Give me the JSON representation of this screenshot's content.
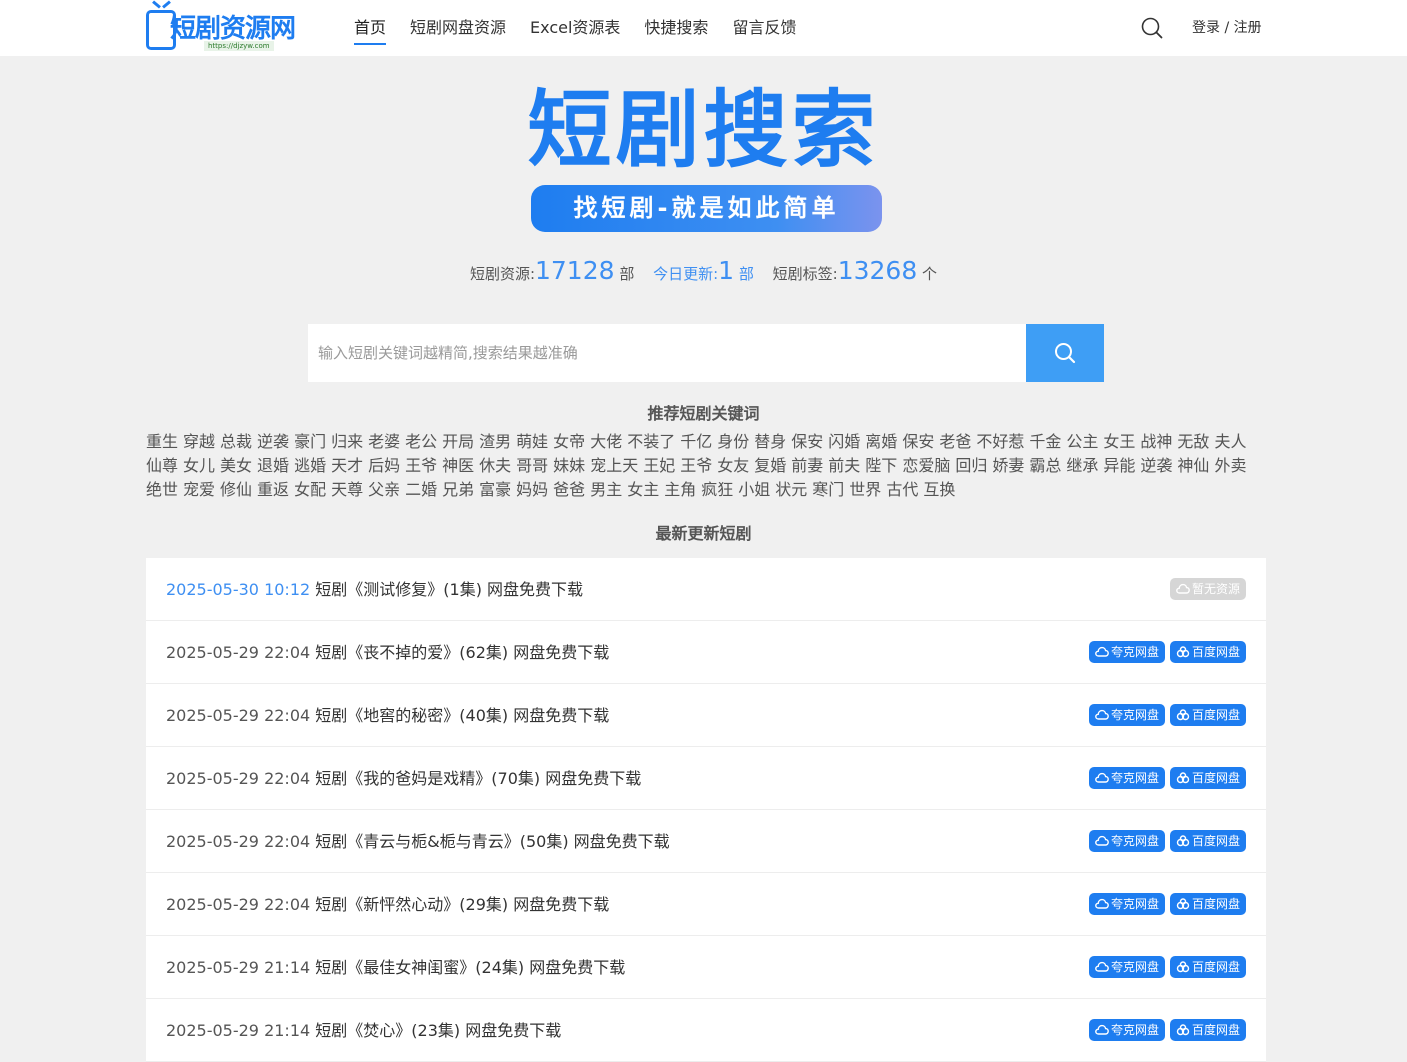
{
  "header": {
    "logo_text": "短剧资源网",
    "logo_url": "https://djzyw.com",
    "nav": [
      "首页",
      "短剧网盘资源",
      "Excel资源表",
      "快捷搜索",
      "留言反馈"
    ],
    "login": "登录",
    "separator": "/",
    "register": "注册"
  },
  "hero": {
    "title": "短剧搜索",
    "subtitle": "找短剧-就是如此简单"
  },
  "stats": {
    "resources_label": "短剧资源:",
    "resources_value": "17128",
    "resources_unit": "部",
    "today_label": "今日更新:",
    "today_value": "1",
    "today_unit": "部",
    "tags_label": "短剧标签:",
    "tags_value": "13268",
    "tags_unit": "个"
  },
  "search": {
    "placeholder": "输入短剧关键词越精简,搜索结果越准确"
  },
  "keywords_title": "推荐短剧关键词",
  "keywords": [
    "重生",
    "穿越",
    "总裁",
    "逆袭",
    "豪门",
    "归来",
    "老婆",
    "老公",
    "开局",
    "渣男",
    "萌娃",
    "女帝",
    "大佬",
    "不装了",
    "千亿",
    "身份",
    "替身",
    "保安",
    "闪婚",
    "离婚",
    "保安",
    "老爸",
    "不好惹",
    "千金",
    "公主",
    "女王",
    "战神",
    "无敌",
    "夫人",
    "仙尊",
    "女儿",
    "美女",
    "退婚",
    "逃婚",
    "天才",
    "后妈",
    "王爷",
    "神医",
    "休夫",
    "哥哥",
    "妹妹",
    "宠上天",
    "王妃",
    "王爷",
    "女友",
    "复婚",
    "前妻",
    "前夫",
    "陛下",
    "恋爱脑",
    "回归",
    "娇妻",
    "霸总",
    "继承",
    "异能",
    "逆袭",
    "神仙",
    "外卖",
    "绝世",
    "宠爱",
    "修仙",
    "重返",
    "女配",
    "天尊",
    "父亲",
    "二婚",
    "兄弟",
    "富豪",
    "妈妈",
    "爸爸",
    "男主",
    "女主",
    "主角",
    "疯狂",
    "小姐",
    "状元",
    "寒门",
    "世界",
    "古代",
    "互换"
  ],
  "latest_title": "最新更新短剧",
  "badge_labels": {
    "quark": "夸克网盘",
    "baidu": "百度网盘",
    "none": "暂无资源"
  },
  "dramas": [
    {
      "date": "2025-05-30 10:12",
      "title": "短剧《测试修复》(1集) 网盘免费下载",
      "available": false
    },
    {
      "date": "2025-05-29 22:04",
      "title": "短剧《丧不掉的爱》(62集) 网盘免费下载",
      "available": true
    },
    {
      "date": "2025-05-29 22:04",
      "title": "短剧《地窖的秘密》(40集) 网盘免费下载",
      "available": true
    },
    {
      "date": "2025-05-29 22:04",
      "title": "短剧《我的爸妈是戏精》(70集) 网盘免费下载",
      "available": true
    },
    {
      "date": "2025-05-29 22:04",
      "title": "短剧《青云与栀&栀与青云》(50集) 网盘免费下载",
      "available": true
    },
    {
      "date": "2025-05-29 22:04",
      "title": "短剧《新怦然心动》(29集) 网盘免费下载",
      "available": true
    },
    {
      "date": "2025-05-29 21:14",
      "title": "短剧《最佳女神闺蜜》(24集) 网盘免费下载",
      "available": true
    },
    {
      "date": "2025-05-29 21:14",
      "title": "短剧《焚心》(23集) 网盘免费下载",
      "available": true
    }
  ]
}
